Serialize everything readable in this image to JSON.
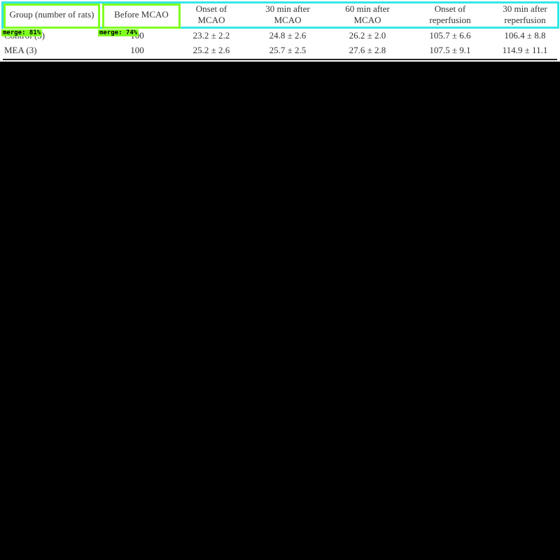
{
  "table": {
    "headers": [
      "Group (number of rats)",
      "Before MCAO",
      "Onset of\nMCAO",
      "30 min after\nMCAO",
      "60 min after\nMCAO",
      "Onset of\nreperfusion",
      "30 min after\nreperfusion"
    ],
    "rows": [
      {
        "group": "Control (3)",
        "values": [
          "100",
          "23.2 ± 2.2",
          "24.8 ± 2.6",
          "26.2 ± 2.0",
          "105.7 ± 6.6",
          "106.4 ± 8.8"
        ]
      },
      {
        "group": "MEA (3)",
        "values": [
          "100",
          "25.2 ± 2.6",
          "25.7 ± 2.5",
          "27.6 ± 2.8",
          "107.5 ± 9.1",
          "114.9 ± 11.1"
        ]
      }
    ]
  },
  "overlays": {
    "outer_color": "#33e6e6",
    "merge_color": "#7fff1f",
    "merge_labels": [
      "merge: 81%",
      "merge: 74%"
    ]
  }
}
